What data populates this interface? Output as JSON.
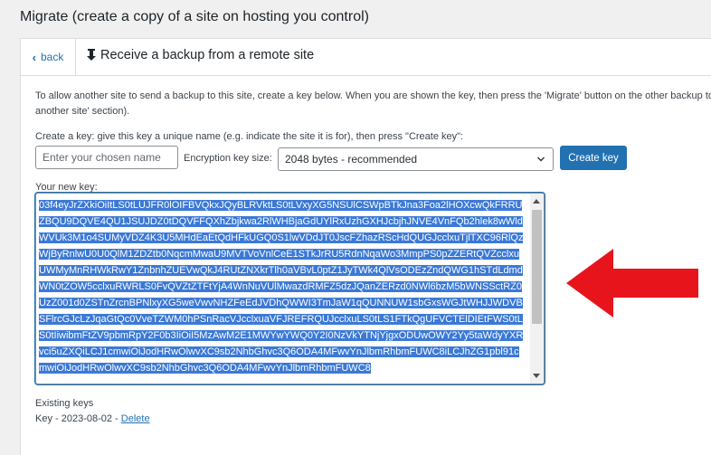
{
  "page": {
    "title": "Migrate (create a copy of a site on hosting you control)"
  },
  "panel": {
    "back_label": "back",
    "title": "Receive a backup from a remote site",
    "intro": "To allow another site to send a backup to this site, create a key below. When you are shown the key, then press the 'Migrate' button on the other backup to another site' section).",
    "create_label": "Create a key: give this key a unique name (e.g. indicate the site it is for), then press \"Create key\":",
    "name_placeholder": "Enter your chosen name",
    "encryption_label": "Encryption key size:",
    "encryption_value": "2048 bytes - recommended",
    "create_button": "Create key",
    "new_key_label": "Your new key:",
    "new_key_value": "03f4eyJrZXkiOiItLS0tLUJFR0lOIFBVQkxJQyBLRVktLS0tLVxyXG5NSUlCSWpBTkJna3Foa2lHOXcwQkFRRUZBQU9DQVE4QU1JSUJDZ0tDQVFFQXhZbjkwa2RlWHBjaGdUYlRxUzhGXHJcbjhJNVE4VnFQb2hlek8wWldWVUk3M1o4SUMyVDZ4K3U5MHdEaEtQdHFkUGQ0S1lwVDdJT0JscFZhazRScHdQUGJcclxuTjlTXC96RlQzWjByRnlwU0U0QlM1ZDZtb0NqcmMwaU9MVTVoVnlCeE1STkJrRU5RdnNqaWo3MmpPS0pZZERtQVZcclxuUWMyMnRHWkRwY1ZnbnhZUEVwQkJ4RUtZNXkrTlh0aVBvL0ptZ1JyTWk4QlVsODEzZndQWG1hSTdLdmdWN0tZOW5cclxuRWRLS0FvQVZtZTFtYjA4WnNuVUlMwazdRMFZ5dzJQanZERzd0NWl6bzM5bWNSSctRZ0UzZ001d0ZSTnZrcnBPNlxyXG5weVwvNHZFeEdJVDhQWWI3TmJaW1qQUNNUW1sbGxsWGJtWHJJWDVBSFlrcGJcLzJqaGtQc0VveTZWM0hPSnRacVJcclxuaVFJREFRQUJcclxuLS0tLS1FTkQgUFVCTElDIEtFWS0tLS0tIiwibmFtZV9pbmRpY2F0b3IiOiI5MzAwM2E1MWYwYWQ0Y2I0NzVkYTNjYjgxODUwOWY2Yy5taWdyYXRvci5uZXQiLCJ1cmwiOiJodHRwOlwvXC9sb2NhbGhvc3Q6ODA4MFwvYnJlbmRhbmFUWC8iLCJhZG1pbl91cmwiOiJodHRwOlwvXC9sb2NhbGhvc3Q6ODA4MFwvYnJlbmRhbmFUWC8"
  },
  "existing_keys": {
    "label": "Existing keys",
    "key_name": "Key - 2023-08-02",
    "separator": " - ",
    "delete_label": "Delete"
  },
  "colors": {
    "accent": "#2271b1",
    "selection": "#3b79d6",
    "annotation_arrow": "#e8141c"
  }
}
